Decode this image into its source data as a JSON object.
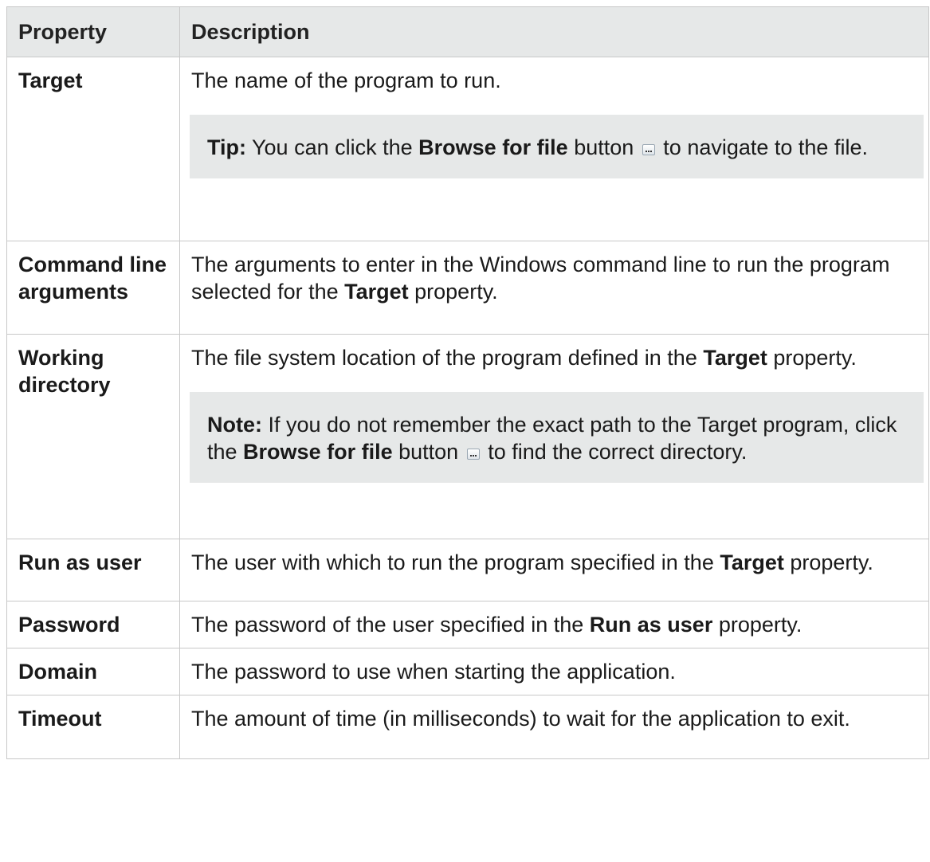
{
  "table": {
    "headers": {
      "property": "Property",
      "description": "Description"
    },
    "rows": [
      {
        "property": "Target",
        "desc": "The name of the program to run.",
        "callout": {
          "label": "Tip:",
          "text_before": " You can click the ",
          "bold": "Browse for file",
          "text_mid": " button",
          "text_after": " to navigate to the file."
        }
      },
      {
        "property": "Command line arguments",
        "desc_before": "The arguments to enter in the Windows command line to run the program selected for the ",
        "desc_bold": "Target",
        "desc_after": " property."
      },
      {
        "property": "Working directory",
        "desc_before": "The file system location of the program defined in the ",
        "desc_bold": "Target",
        "desc_after": " property.",
        "callout": {
          "label": "Note:",
          "text_before": " If you do not remember the exact path to the Target program, click the ",
          "bold": "Browse for file",
          "text_mid": " button",
          "text_after": " to find the correct directory."
        }
      },
      {
        "property": "Run as user",
        "desc_before": "The user with which to run the program specified in the ",
        "desc_bold": "Target",
        "desc_after": " property."
      },
      {
        "property": "Password",
        "desc_before": "The password of the user specified in the ",
        "desc_bold": "Run as user",
        "desc_after": " property."
      },
      {
        "property": "Domain",
        "desc": "The password to use when starting the application."
      },
      {
        "property": "Timeout",
        "desc": "The amount of time (in milliseconds) to wait for the application to exit."
      }
    ]
  },
  "icons": {
    "browse_button": "browse-ellipsis-icon"
  }
}
